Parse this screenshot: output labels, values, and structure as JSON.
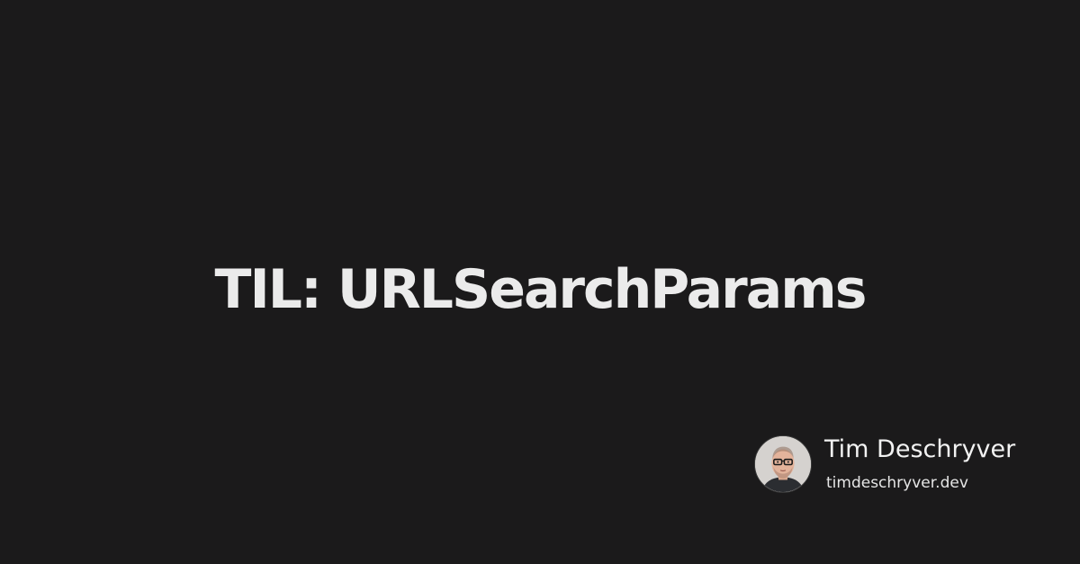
{
  "post": {
    "title": "TIL: URLSearchParams"
  },
  "author": {
    "name": "Tim Deschryver",
    "site": "timdeschryver.dev",
    "avatar_icon": "author-portrait"
  },
  "colors": {
    "background": "#1b1a1b",
    "text": "#ebebeb"
  }
}
